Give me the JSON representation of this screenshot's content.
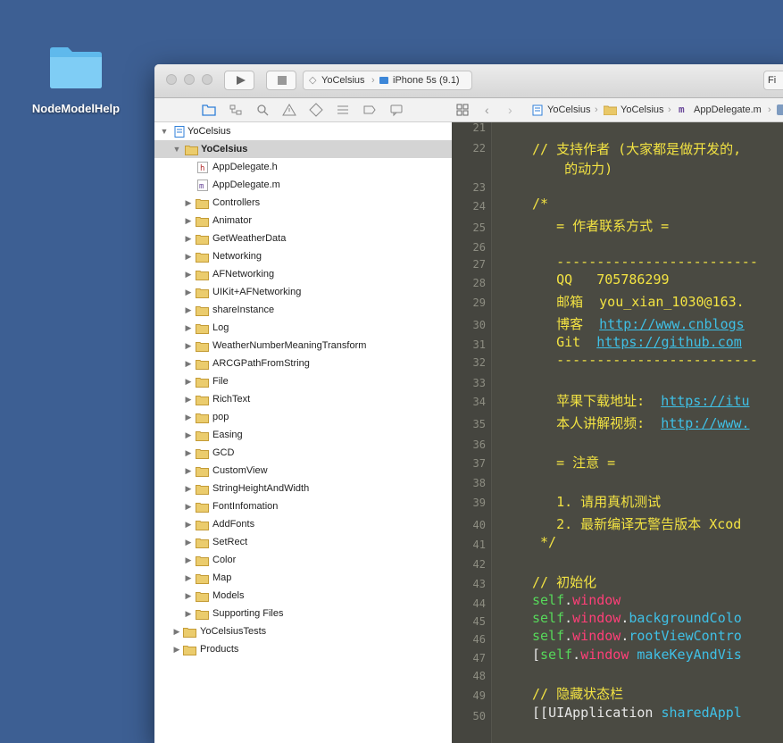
{
  "desktop": {
    "folder_label": "NodeModelHelp"
  },
  "toolbar": {
    "scheme_name": "YoCelsius",
    "device_name": "iPhone 5s (9.1)",
    "activity_text": "Fi"
  },
  "jumpbar": {
    "items": [
      "YoCelsius",
      "YoCelsius",
      "AppDelegate.m"
    ]
  },
  "navigator": {
    "project": "YoCelsius",
    "group": "YoCelsius",
    "files": [
      "AppDelegate.h",
      "AppDelegate.m"
    ],
    "folders": [
      "Controllers",
      "Animator",
      "GetWeatherData",
      "Networking",
      "AFNetworking",
      "UIKit+AFNetworking",
      "shareInstance",
      "Log",
      "WeatherNumberMeaningTransform",
      "ARCGPathFromString",
      "File",
      "RichText",
      "pop",
      "Easing",
      "GCD",
      "CustomView",
      "StringHeightAndWidth",
      "FontInfomation",
      "AddFonts",
      "SetRect",
      "Color",
      "Map",
      "Models",
      "Supporting Files"
    ],
    "top_groups": [
      "YoCelsiusTests",
      "Products"
    ]
  },
  "editor": {
    "line_numbers": [
      "21",
      "22",
      "23",
      "24",
      "25",
      "26",
      "27",
      "28",
      "29",
      "30",
      "31",
      "32",
      "33",
      "34",
      "35",
      "36",
      "37",
      "38",
      "39",
      "40",
      "41",
      "42",
      "43",
      "44",
      "45",
      "46",
      "47",
      "48",
      "49",
      "50"
    ],
    "lines": {
      "l22a": "// 支持作者 (大家都是做开发的,",
      "l22b": "    的动力)",
      "l24": "/*",
      "l25": "   = 作者联系方式 =",
      "l27": "   -------------------------",
      "l28": "   QQ   705786299",
      "l29": "   邮箱  you_xian_1030@163.",
      "l30_a": "   博客  ",
      "l30_b": "http://www.cnblogs",
      "l31_a": "   Git  ",
      "l31_b": "https://github.com",
      "l32": "   -------------------------",
      "l34_a": "   苹果下载地址:  ",
      "l34_b": "https://itu",
      "l35_a": "   本人讲解视频:  ",
      "l35_b": "http://www.",
      "l37": "   = 注意 =",
      "l39": "   1. 请用真机测试",
      "l40": "   2. 最新编译无警告版本 Xcod",
      "l41": " */",
      "l43": "// 初始化",
      "l44_self": "self",
      "l44_win": "window",
      "l45_bg": "backgroundColo",
      "l46_root": "rootViewContro",
      "l47_make": "makeKeyAndVis",
      "l49": "// 隐藏状态栏",
      "l50_cls": "UIApplication",
      "l50_m": "sharedAppl"
    }
  }
}
